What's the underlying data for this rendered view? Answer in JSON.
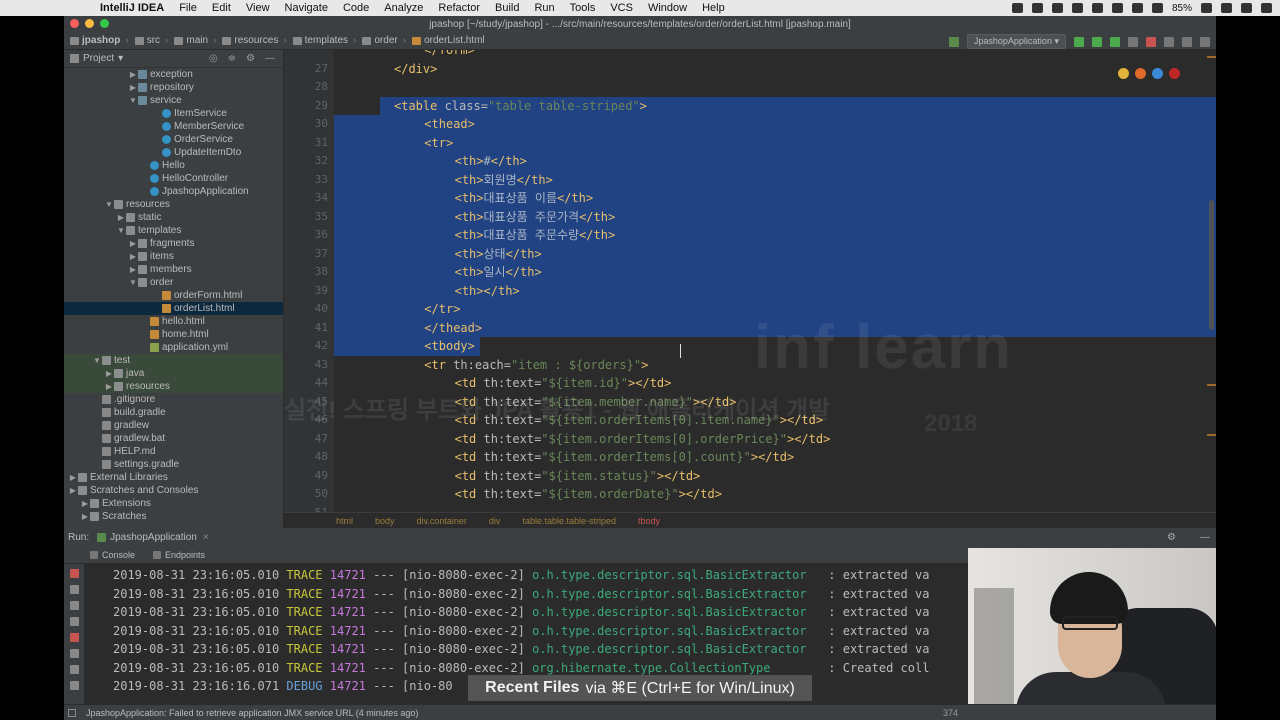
{
  "menubar": {
    "items": [
      "IntelliJ IDEA",
      "File",
      "Edit",
      "View",
      "Navigate",
      "Code",
      "Analyze",
      "Refactor",
      "Build",
      "Run",
      "Tools",
      "VCS",
      "Window",
      "Help"
    ],
    "battery": "85%"
  },
  "window": {
    "title": "jpashop [~/study/jpashop] - .../src/main/resources/templates/order/orderList.html [jpashop.main]"
  },
  "navbar": {
    "crumbs": [
      "jpashop",
      "src",
      "main",
      "resources",
      "templates",
      "order",
      "orderList.html"
    ],
    "run_config": "JpashopApplication"
  },
  "project": {
    "header": "Project",
    "tree": [
      {
        "label": "exception",
        "indent": 5,
        "type": "pkg",
        "arrow": "▶"
      },
      {
        "label": "repository",
        "indent": 5,
        "type": "pkg",
        "arrow": "▶"
      },
      {
        "label": "service",
        "indent": 5,
        "type": "pkg",
        "arrow": "▼"
      },
      {
        "label": "ItemService",
        "indent": 7,
        "type": "cls",
        "arrow": ""
      },
      {
        "label": "MemberService",
        "indent": 7,
        "type": "cls",
        "arrow": ""
      },
      {
        "label": "OrderService",
        "indent": 7,
        "type": "cls",
        "arrow": ""
      },
      {
        "label": "UpdateItemDto",
        "indent": 7,
        "type": "cls",
        "arrow": ""
      },
      {
        "label": "Hello",
        "indent": 6,
        "type": "cls",
        "arrow": ""
      },
      {
        "label": "HelloController",
        "indent": 6,
        "type": "cls",
        "arrow": ""
      },
      {
        "label": "JpashopApplication",
        "indent": 6,
        "type": "cls",
        "arrow": ""
      },
      {
        "label": "resources",
        "indent": 3,
        "type": "folder",
        "arrow": "▼"
      },
      {
        "label": "static",
        "indent": 4,
        "type": "folder",
        "arrow": "▶"
      },
      {
        "label": "templates",
        "indent": 4,
        "type": "folder",
        "arrow": "▼"
      },
      {
        "label": "fragments",
        "indent": 5,
        "type": "folder",
        "arrow": "▶"
      },
      {
        "label": "items",
        "indent": 5,
        "type": "folder",
        "arrow": "▶"
      },
      {
        "label": "members",
        "indent": 5,
        "type": "folder",
        "arrow": "▶"
      },
      {
        "label": "order",
        "indent": 5,
        "type": "folder",
        "arrow": "▼"
      },
      {
        "label": "orderForm.html",
        "indent": 7,
        "type": "file",
        "arrow": ""
      },
      {
        "label": "orderList.html",
        "indent": 7,
        "type": "file",
        "arrow": "",
        "selected": true
      },
      {
        "label": "hello.html",
        "indent": 6,
        "type": "file",
        "arrow": ""
      },
      {
        "label": "home.html",
        "indent": 6,
        "type": "file",
        "arrow": ""
      },
      {
        "label": "application.yml",
        "indent": 6,
        "type": "yml",
        "arrow": ""
      },
      {
        "label": "test",
        "indent": 2,
        "type": "folder",
        "arrow": "▼",
        "green": true
      },
      {
        "label": "java",
        "indent": 3,
        "type": "folder",
        "arrow": "▶",
        "green": true
      },
      {
        "label": "resources",
        "indent": 3,
        "type": "folder",
        "arrow": "▶",
        "green": true
      },
      {
        "label": ".gitignore",
        "indent": 2,
        "type": "git",
        "arrow": ""
      },
      {
        "label": "build.gradle",
        "indent": 2,
        "type": "git",
        "arrow": ""
      },
      {
        "label": "gradlew",
        "indent": 2,
        "type": "git",
        "arrow": ""
      },
      {
        "label": "gradlew.bat",
        "indent": 2,
        "type": "git",
        "arrow": ""
      },
      {
        "label": "HELP.md",
        "indent": 2,
        "type": "git",
        "arrow": ""
      },
      {
        "label": "settings.gradle",
        "indent": 2,
        "type": "git",
        "arrow": ""
      },
      {
        "label": "External Libraries",
        "indent": 0,
        "type": "folder",
        "arrow": "▶"
      },
      {
        "label": "Scratches and Consoles",
        "indent": 0,
        "type": "folder",
        "arrow": "▶"
      },
      {
        "label": "Extensions",
        "indent": 1,
        "type": "folder",
        "arrow": "▶"
      },
      {
        "label": "Scratches",
        "indent": 1,
        "type": "folder",
        "arrow": "▶"
      }
    ]
  },
  "editor": {
    "lines": [
      {
        "n": "",
        "indent": 2,
        "html": "</form>",
        "partial": true
      },
      {
        "n": "27",
        "indent": 1,
        "html": "</div>"
      },
      {
        "n": "28",
        "indent": 0,
        "html": ""
      },
      {
        "n": "29",
        "indent": 1,
        "html": "<table class=\"table table-striped\">",
        "sel": "partial"
      },
      {
        "n": "30",
        "indent": 2,
        "html": "<thead>",
        "sel": "full"
      },
      {
        "n": "31",
        "indent": 2,
        "html": "<tr>",
        "sel": "full"
      },
      {
        "n": "32",
        "indent": 3,
        "html": "<th>#</th>",
        "sel": "full"
      },
      {
        "n": "33",
        "indent": 3,
        "html": "<th>회원명</th>",
        "sel": "full"
      },
      {
        "n": "34",
        "indent": 3,
        "html": "<th>대표상품 이름</th>",
        "sel": "full"
      },
      {
        "n": "35",
        "indent": 3,
        "html": "<th>대표상품 주문가격</th>",
        "sel": "full"
      },
      {
        "n": "36",
        "indent": 3,
        "html": "<th>대표상품 주문수량</th>",
        "sel": "full"
      },
      {
        "n": "37",
        "indent": 3,
        "html": "<th>상태</th>",
        "sel": "full"
      },
      {
        "n": "38",
        "indent": 3,
        "html": "<th>일시</th>",
        "sel": "full"
      },
      {
        "n": "39",
        "indent": 3,
        "html": "<th></th>",
        "sel": "full"
      },
      {
        "n": "40",
        "indent": 2,
        "html": "</tr>",
        "sel": "full"
      },
      {
        "n": "41",
        "indent": 2,
        "html": "</thead>",
        "sel": "full"
      },
      {
        "n": "42",
        "indent": 2,
        "html": "<tbody>",
        "sel": "end"
      },
      {
        "n": "43",
        "indent": 2,
        "html": "<tr th:each=\"item : ${orders}\">"
      },
      {
        "n": "44",
        "indent": 3,
        "html": "<td th:text=\"${item.id}\"></td>"
      },
      {
        "n": "45",
        "indent": 3,
        "html": "<td th:text=\"${item.member.name}\"></td>"
      },
      {
        "n": "46",
        "indent": 3,
        "html": "<td th:text=\"${item.orderItems[0].item.name}\"></td>"
      },
      {
        "n": "47",
        "indent": 3,
        "html": "<td th:text=\"${item.orderItems[0].orderPrice}\"></td>"
      },
      {
        "n": "48",
        "indent": 3,
        "html": "<td th:text=\"${item.orderItems[0].count}\"></td>"
      },
      {
        "n": "49",
        "indent": 3,
        "html": "<td th:text=\"${item.status}\"></td>"
      },
      {
        "n": "50",
        "indent": 3,
        "html": "<td th:text=\"${item.orderDate}\"></td>"
      },
      {
        "n": "51",
        "indent": 0,
        "html": ""
      }
    ],
    "breadcrumbs": [
      "html",
      "body",
      "div.container",
      "div",
      "table.table.table-striped",
      "tbody"
    ],
    "watermark": "inf learn",
    "watermark_year": "2018",
    "watermark_course": "실전! 스프링 부트와 JPA 활용1 - 웹 애플리케이션 개발"
  },
  "run": {
    "label": "Run:",
    "tab": "JpashopApplication",
    "subtabs": [
      "Console",
      "Endpoints"
    ],
    "logs": [
      {
        "ts": "2019-08-31 23:16:05.010",
        "lvl": "TRACE",
        "pid": "14721",
        "thread": "--- [nio-8080-exec-2]",
        "cls": "o.h.type.descriptor.sql.BasicExtractor  ",
        "msg": " : extracted va"
      },
      {
        "ts": "2019-08-31 23:16:05.010",
        "lvl": "TRACE",
        "pid": "14721",
        "thread": "--- [nio-8080-exec-2]",
        "cls": "o.h.type.descriptor.sql.BasicExtractor  ",
        "msg": " : extracted va"
      },
      {
        "ts": "2019-08-31 23:16:05.010",
        "lvl": "TRACE",
        "pid": "14721",
        "thread": "--- [nio-8080-exec-2]",
        "cls": "o.h.type.descriptor.sql.BasicExtractor  ",
        "msg": " : extracted va"
      },
      {
        "ts": "2019-08-31 23:16:05.010",
        "lvl": "TRACE",
        "pid": "14721",
        "thread": "--- [nio-8080-exec-2]",
        "cls": "o.h.type.descriptor.sql.BasicExtractor  ",
        "msg": " : extracted va"
      },
      {
        "ts": "2019-08-31 23:16:05.010",
        "lvl": "TRACE",
        "pid": "14721",
        "thread": "--- [nio-8080-exec-2]",
        "cls": "o.h.type.descriptor.sql.BasicExtractor  ",
        "msg": " : extracted va"
      },
      {
        "ts": "2019-08-31 23:16:05.010",
        "lvl": "TRACE",
        "pid": "14721",
        "thread": "--- [nio-8080-exec-2]",
        "cls": "org.hibernate.type.CollectionType       ",
        "msg": " : Created coll"
      },
      {
        "ts": "2019-08-31 23:16:16.071",
        "lvl": "DEBUG",
        "pid": "14721",
        "thread": "--- [nio-80",
        "cls": "",
        "msg": ""
      }
    ]
  },
  "tooltip": {
    "title": "Recent Files",
    "rest": "via ⌘E (Ctrl+E for Win/Linux)"
  },
  "status": {
    "message": "JpashopApplication: Failed to retrieve application JMX service URL (4 minutes ago)",
    "right": "374"
  }
}
